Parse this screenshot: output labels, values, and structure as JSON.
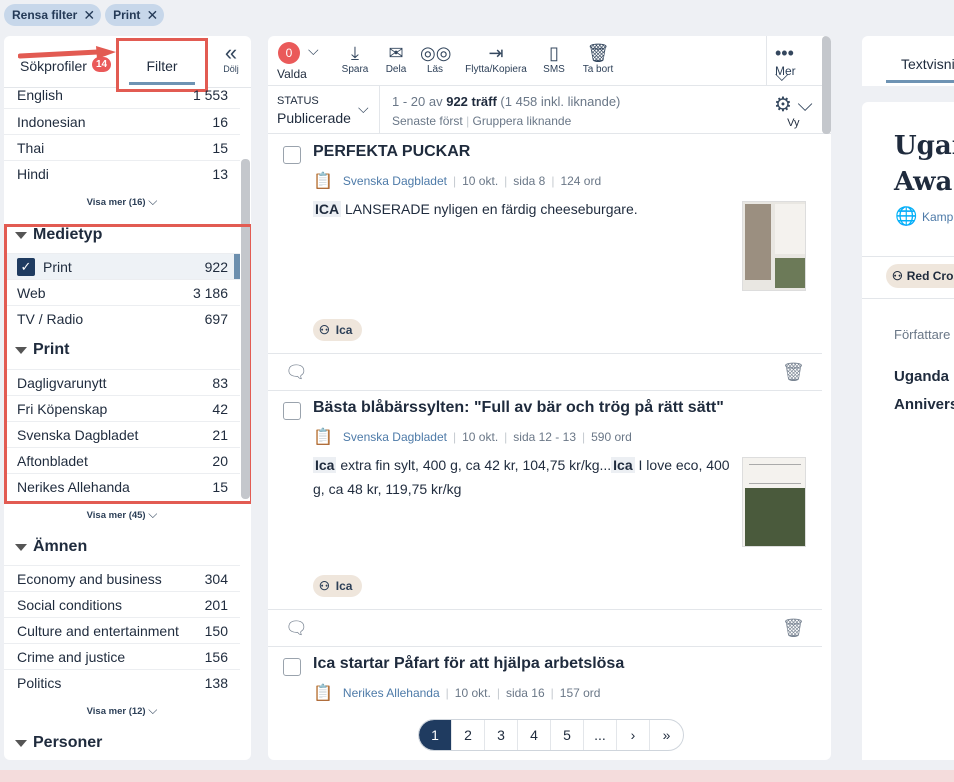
{
  "chips": [
    {
      "label": "Rensa filter"
    },
    {
      "label": "Print"
    }
  ],
  "left": {
    "tab_sokprofiler": "Sökprofiler",
    "badge": "14",
    "tab_filter": "Filter",
    "dolj": "Dölj",
    "languages": [
      {
        "label": "English",
        "count": "1 553"
      },
      {
        "label": "Indonesian",
        "count": "16"
      },
      {
        "label": "Thai",
        "count": "15"
      },
      {
        "label": "Hindi",
        "count": "13"
      }
    ],
    "languages_more": "Visa mer (16)",
    "medietyp_title": "Medietyp",
    "medietyp": [
      {
        "label": "Print",
        "count": "922"
      },
      {
        "label": "Web",
        "count": "3 186"
      },
      {
        "label": "TV / Radio",
        "count": "697"
      }
    ],
    "print_title": "Print",
    "print": [
      {
        "label": "Dagligvarunytt",
        "count": "83"
      },
      {
        "label": "Fri Köpenskap",
        "count": "42"
      },
      {
        "label": "Svenska Dagbladet",
        "count": "21"
      },
      {
        "label": "Aftonbladet",
        "count": "20"
      },
      {
        "label": "Nerikes Allehanda",
        "count": "15"
      }
    ],
    "print_more": "Visa mer (45)",
    "amnen_title": "Ämnen",
    "amnen": [
      {
        "label": "Economy and business",
        "count": "304"
      },
      {
        "label": "Social conditions",
        "count": "201"
      },
      {
        "label": "Culture and entertainment",
        "count": "150"
      },
      {
        "label": "Crime and justice",
        "count": "156"
      },
      {
        "label": "Politics",
        "count": "138"
      }
    ],
    "amnen_more": "Visa mer (12)",
    "personer_title": "Personer"
  },
  "toolbar": {
    "valda_count": "0",
    "valda": "Valda",
    "spara": "Spara",
    "dela": "Dela",
    "las": "Läs",
    "flytta": "Flytta/Kopiera",
    "sms": "SMS",
    "tabort": "Ta bort",
    "mer": "Mer"
  },
  "status": {
    "label": "STATUS",
    "value": "Publicerade",
    "hits_prefix": "1 - 20 av",
    "hits_bold": "922 träff",
    "hits_suffix": "(1 458 inkl. liknande)",
    "sort": "Senaste först",
    "group": "Gruppera liknande",
    "vy": "Vy"
  },
  "articles": [
    {
      "title": "PERFEKTA PUCKAR",
      "source": "Svenska Dagbladet",
      "date": "10 okt.",
      "page": "sida 8",
      "words": "124 ord",
      "hl1": "ICA",
      "text1": " LANSERADE nyligen en färdig cheeseburgare.",
      "tag": "Ica"
    },
    {
      "title": "Bästa blåbärssylten: \"Full av bär och trög på rätt sätt\"",
      "source": "Svenska Dagbladet",
      "date": "10 okt.",
      "page": "sida 12 - 13",
      "words": "590 ord",
      "hl1": "Ica",
      "text1": " extra fin sylt, 400 g, ca 42 kr, 104,75 kr/kg...",
      "hl2": "Ica",
      "text2": " I love eco, 400 g, ca 48 kr, 119,75 kr/kg",
      "tag": "Ica"
    },
    {
      "title": "Ica startar Påfart för att hjälpa arbetslösa",
      "source": "Nerikes Allehanda",
      "date": "10 okt.",
      "page": "sida 16",
      "words": "157 ord"
    }
  ],
  "pager": [
    "1",
    "2",
    "3",
    "4",
    "5",
    "..."
  ],
  "right": {
    "tab": "Textvisning",
    "title_l1": "Ugan",
    "title_l2": "Awa",
    "kamp": "Kamp",
    "tag": "Red Cros",
    "author": "Författare",
    "line1": "Uganda",
    "line2": "Annivers"
  },
  "colors": {
    "accent": "#1f3b60",
    "highlight_box": "#e25b52",
    "badge": "#ea5a5a"
  }
}
